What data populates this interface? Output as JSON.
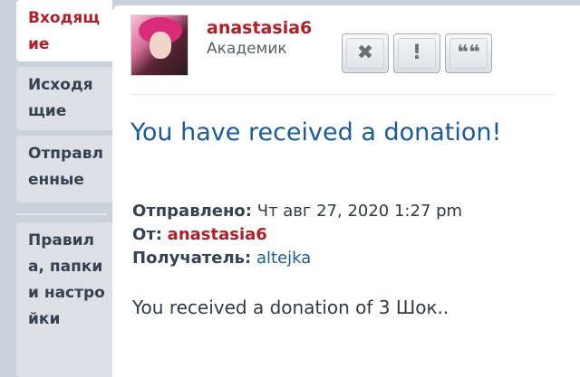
{
  "sidebar": {
    "items": [
      {
        "label": "Входящие",
        "active": true
      },
      {
        "label": "Исходящие",
        "active": false
      },
      {
        "label": "Отправленные",
        "active": false
      },
      {
        "label": "Правила, папки и настройки",
        "active": false
      }
    ]
  },
  "message": {
    "author": "anastasia6",
    "author_rank": "Академик",
    "actions": {
      "close": "✖",
      "report": "!",
      "quote": "❝❝"
    },
    "title": "You have received a donation!",
    "sent_label": "Отправлено:",
    "sent_value": "Чт авг 27, 2020 1:27 pm",
    "from_label": "От:",
    "from_value": "anastasia6",
    "to_label": "Получатель:",
    "to_value": "altejka",
    "body": "You received a donation of 3 Шок.."
  }
}
